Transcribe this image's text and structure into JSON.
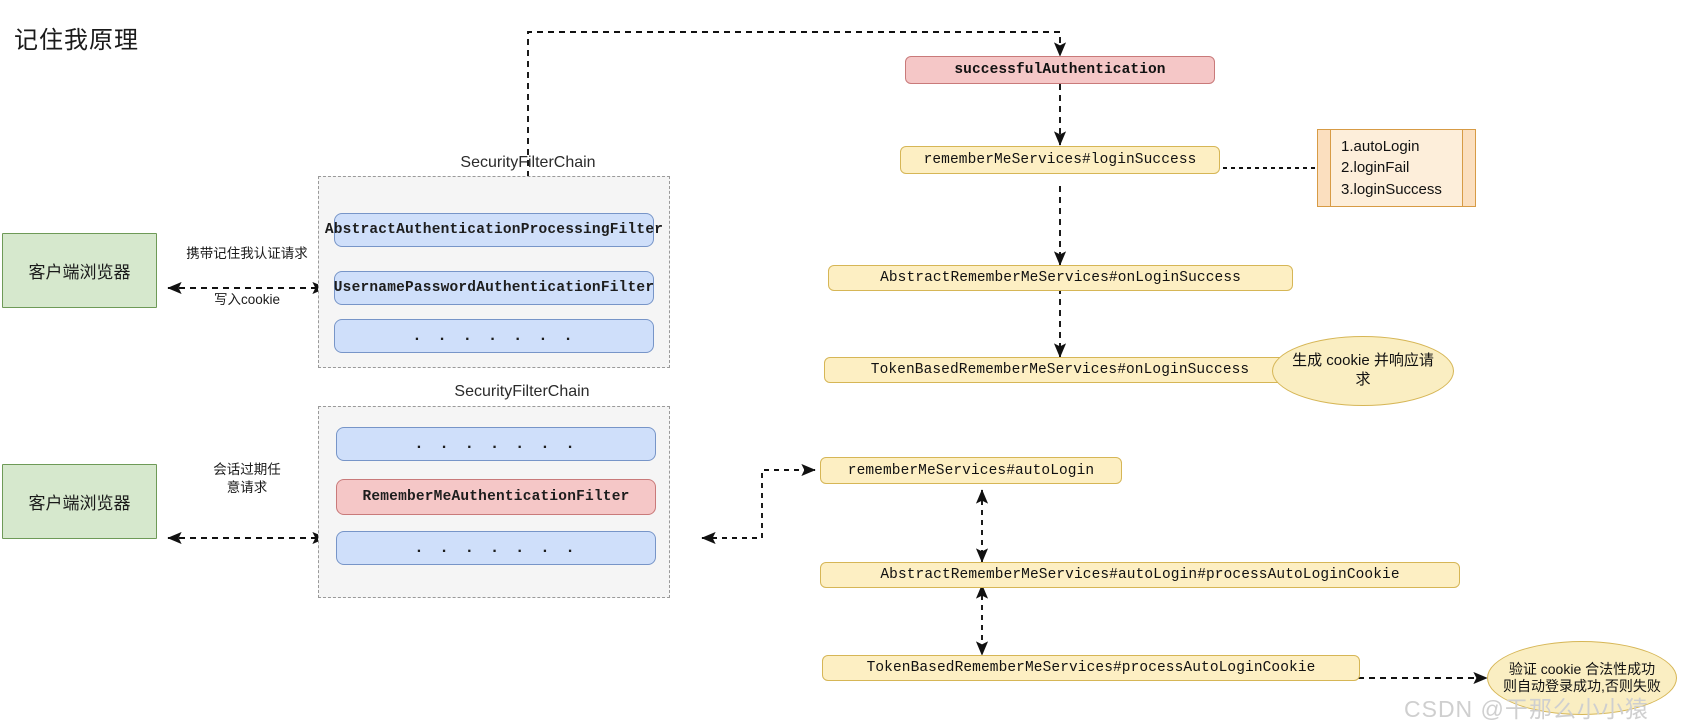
{
  "page": {
    "title": "记住我原理",
    "watermark": "CSDN @干那么小小猿"
  },
  "groups": [
    {
      "label": "SecurityFilterChain"
    },
    {
      "label": "SecurityFilterChain"
    }
  ],
  "clients": [
    {
      "label": "客户端浏览器"
    },
    {
      "label": "客户端浏览器"
    }
  ],
  "filters_top": [
    {
      "label": "AbstractAuthenticationProcessingFilter"
    },
    {
      "label": "UsernamePasswordAuthenticationFilter"
    },
    {
      "label": ". . . . . . ."
    }
  ],
  "filters_bottom": [
    {
      "label": ". . . . . . ."
    },
    {
      "label": "RememberMeAuthenticationFilter"
    },
    {
      "label": ". . . . . . ."
    }
  ],
  "methods_top": [
    {
      "label": "successfulAuthentication"
    },
    {
      "label": "rememberMeServices#loginSuccess"
    },
    {
      "label": "AbstractRememberMeServices#onLoginSuccess"
    },
    {
      "label": "TokenBasedRememberMeServices#onLoginSuccess"
    }
  ],
  "methods_bottom": [
    {
      "label": "rememberMeServices#autoLogin"
    },
    {
      "label": "AbstractRememberMeServices#autoLogin#processAutoLoginCookie"
    },
    {
      "label": "TokenBasedRememberMeServices#processAutoLoginCookie"
    }
  ],
  "notes": {
    "list_items": [
      "1.autoLogin",
      "2.loginFail",
      "3.loginSuccess"
    ],
    "ellipse_top": "生成 cookie 并响应请求",
    "ellipse_bottom": "验证 cookie 合法性成功则自动登录成功,否则失败"
  },
  "edge_labels": {
    "top_request": "携带记住我认证请求",
    "top_cookie": "写入cookie",
    "bottom_request": "会话过期任\n意请求"
  },
  "colors": {
    "filter_blue_fill": "#cfdffa",
    "filter_blue_stroke": "#7795c8",
    "red_fill": "#f5c7c7",
    "red_stroke": "#c97a7a",
    "yellow_fill": "#fdefc3",
    "yellow_stroke": "#d6b656",
    "green_fill": "#d6e8cd",
    "green_stroke": "#6e9a57",
    "note_fill": "#fdeeda",
    "note_stroke": "#d79b45",
    "group_fill": "#f5f5f5",
    "group_stroke": "#9a9a9a"
  }
}
